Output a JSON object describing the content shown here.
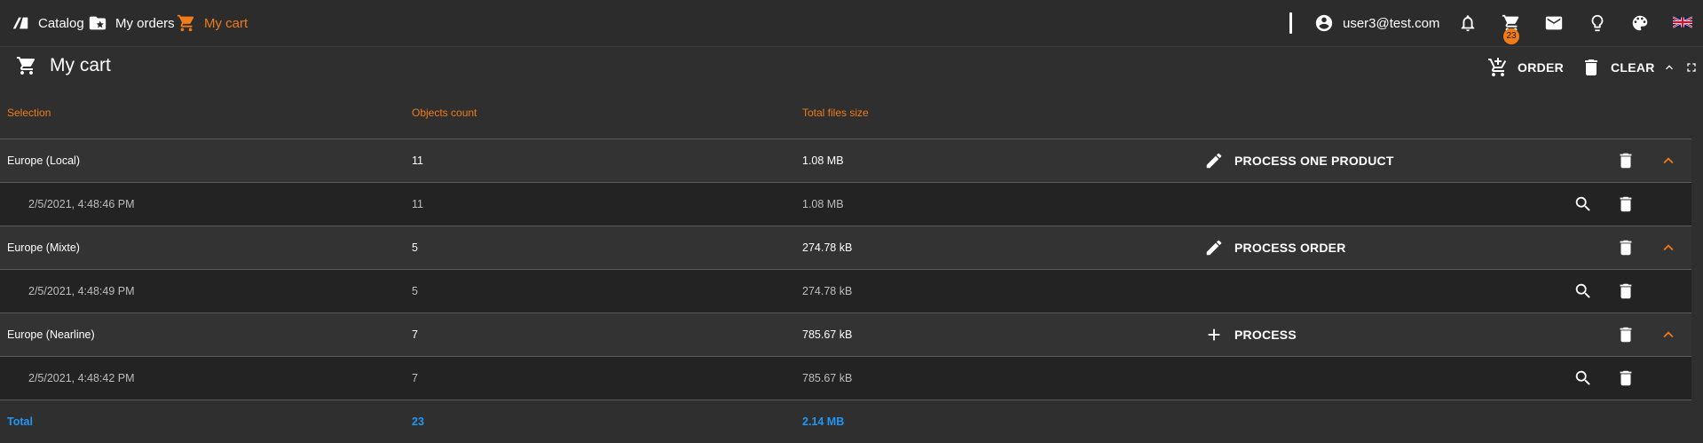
{
  "nav": {
    "catalog": "Catalog",
    "orders": "My orders",
    "cart": "My cart"
  },
  "user": {
    "email": "user3@test.com"
  },
  "cart_badge": "23",
  "page": {
    "title": "My cart",
    "order_label": "ORDER",
    "clear_label": "CLEAR"
  },
  "columns": {
    "selection": "Selection",
    "count": "Objects count",
    "size": "Total files size"
  },
  "groups": [
    {
      "name": "Europe (Local)",
      "count": "11",
      "size": "1.08 MB",
      "action": "PROCESS ONE PRODUCT",
      "action_icon": "pencil-icon",
      "detail": {
        "date": "2/5/2021, 4:48:46 PM",
        "count": "11",
        "size": "1.08 MB"
      }
    },
    {
      "name": "Europe (Mixte)",
      "count": "5",
      "size": "274.78 kB",
      "action": "PROCESS ORDER",
      "action_icon": "pencil-icon",
      "detail": {
        "date": "2/5/2021, 4:48:49 PM",
        "count": "5",
        "size": "274.78 kB"
      }
    },
    {
      "name": "Europe (Nearline)",
      "count": "7",
      "size": "785.67 kB",
      "action": "PROCESS",
      "action_icon": "plus-icon",
      "detail": {
        "date": "2/5/2021, 4:48:42 PM",
        "count": "7",
        "size": "785.67 kB"
      }
    }
  ],
  "total": {
    "label": "Total",
    "count": "23",
    "size": "2.14 MB"
  },
  "colors": {
    "accent": "#f07b17",
    "total": "#2196f3",
    "background": "#2f2f2f"
  }
}
